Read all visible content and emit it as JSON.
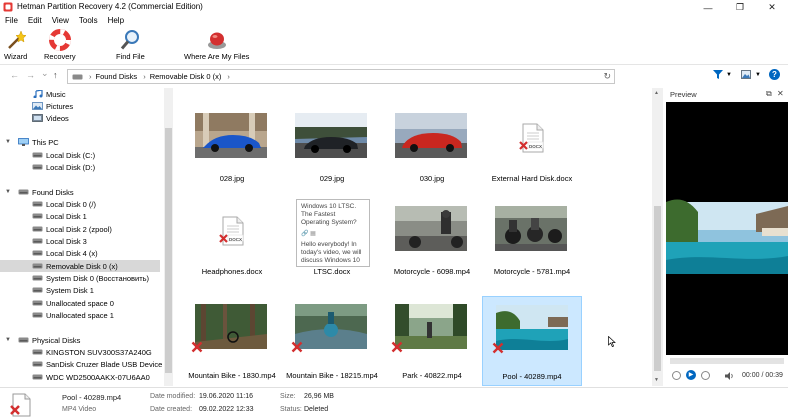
{
  "window": {
    "title": "Hetman Partition Recovery 4.2 (Commercial Edition)",
    "min_glyph": "—",
    "restore_glyph": "❐",
    "close_glyph": "✕"
  },
  "menu": [
    "File",
    "Edit",
    "View",
    "Tools",
    "Help"
  ],
  "toolbar": {
    "wizard": "Wizard",
    "recovery": "Recovery",
    "find_file": "Find File",
    "where_files": "Where Are My Files"
  },
  "address": {
    "back": "←",
    "forward": "→",
    "dropdown": "⌄",
    "up": "↑",
    "crumbs": [
      "Found Disks",
      "Removable Disk 0 (x)"
    ],
    "refresh": "↻",
    "help": "?"
  },
  "tree": [
    {
      "label": "Music",
      "icon": "music-icon",
      "expander": ""
    },
    {
      "label": "Pictures",
      "icon": "pictures-icon",
      "expander": ""
    },
    {
      "label": "Videos",
      "icon": "videos-icon",
      "expander": ""
    },
    {
      "label": "This PC",
      "icon": "computer-icon",
      "expander": "▼"
    },
    {
      "label": "Local Disk (C:)",
      "icon": "drive-icon",
      "expander": ""
    },
    {
      "label": "Local Disk (D:)",
      "icon": "drive-icon",
      "expander": ""
    },
    {
      "label": "Found Disks",
      "icon": "drive-icon",
      "expander": "▼"
    },
    {
      "label": "Local Disk 0 (/)",
      "icon": "drive-icon",
      "expander": ""
    },
    {
      "label": "Local Disk 1",
      "icon": "drive-icon",
      "expander": ""
    },
    {
      "label": "Local Disk 2 (zpool)",
      "icon": "drive-icon",
      "expander": ""
    },
    {
      "label": "Local Disk 3",
      "icon": "drive-icon",
      "expander": ""
    },
    {
      "label": "Local Disk 4 (x)",
      "icon": "drive-icon",
      "expander": ""
    },
    {
      "label": "Removable Disk 0 (x)",
      "icon": "drive-icon",
      "expander": "",
      "selected": true
    },
    {
      "label": "System Disk 0 (Восстановить)",
      "icon": "drive-icon",
      "expander": ""
    },
    {
      "label": "System Disk 1",
      "icon": "drive-icon",
      "expander": ""
    },
    {
      "label": "Unallocated space 0",
      "icon": "drive-icon",
      "expander": ""
    },
    {
      "label": "Unallocated space 1",
      "icon": "drive-icon",
      "expander": ""
    },
    {
      "label": "Physical Disks",
      "icon": "drive-icon",
      "expander": "▼"
    },
    {
      "label": "KINGSTON SUV300S37A240G",
      "icon": "drive-icon",
      "expander": ""
    },
    {
      "label": "SanDisk Cruzer Blade USB Device",
      "icon": "drive-icon",
      "expander": ""
    },
    {
      "label": "WDC WD2500AAKX-07U6AA0",
      "icon": "drive-icon",
      "expander": ""
    }
  ],
  "files": [
    {
      "name": "028.jpg",
      "kind": "car-blue",
      "deleted": false
    },
    {
      "name": "029.jpg",
      "kind": "car-dark",
      "deleted": false
    },
    {
      "name": "030.jpg",
      "kind": "car-red",
      "deleted": false
    },
    {
      "name": "External Hard Disk.docx",
      "kind": "docx",
      "deleted": true
    },
    {
      "name": "Headphones.docx",
      "kind": "docx",
      "deleted": true
    },
    {
      "name": "LTSC.docx",
      "kind": "tooltip",
      "deleted": false
    },
    {
      "name": "Motorcycle - 6098.mp4",
      "kind": "moto-1",
      "deleted": false
    },
    {
      "name": "Motorcycle - 5781.mp4",
      "kind": "moto-2",
      "deleted": false
    },
    {
      "name": "Mountain Bike - 1830.mp4",
      "kind": "bike-1",
      "deleted": true
    },
    {
      "name": "Mountain Bike - 18215.mp4",
      "kind": "bike-2",
      "deleted": true
    },
    {
      "name": "Park - 40822.mp4",
      "kind": "park",
      "deleted": true
    },
    {
      "name": "Pool - 40289.mp4",
      "kind": "pool",
      "deleted": true,
      "selected": true
    }
  ],
  "docx_badge": "DOCX",
  "tooltip": {
    "heading": "Windows 10 LTSC. The Fastest Operating System?",
    "body": "Hello everybody! In today's video, we will discuss Windows 10"
  },
  "preview": {
    "title": "Preview",
    "time": "00:00 / 00:39"
  },
  "status": {
    "file_name": "Pool - 40289.mp4",
    "file_type": "MP4 Video",
    "modified_label": "Date modified:",
    "modified_value": "19.06.2020 11:16",
    "created_label": "Date created:",
    "created_value": "09.02.2022 12:33",
    "size_label": "Size:",
    "size_value": "26,96 MB",
    "status_label": "Status:",
    "status_value": "Deleted"
  },
  "colors": {
    "selection": "#cce8ff",
    "tree_selection": "#d8d8d8",
    "deleted_mark": "#d32f2f",
    "accent": "#0067c0"
  }
}
